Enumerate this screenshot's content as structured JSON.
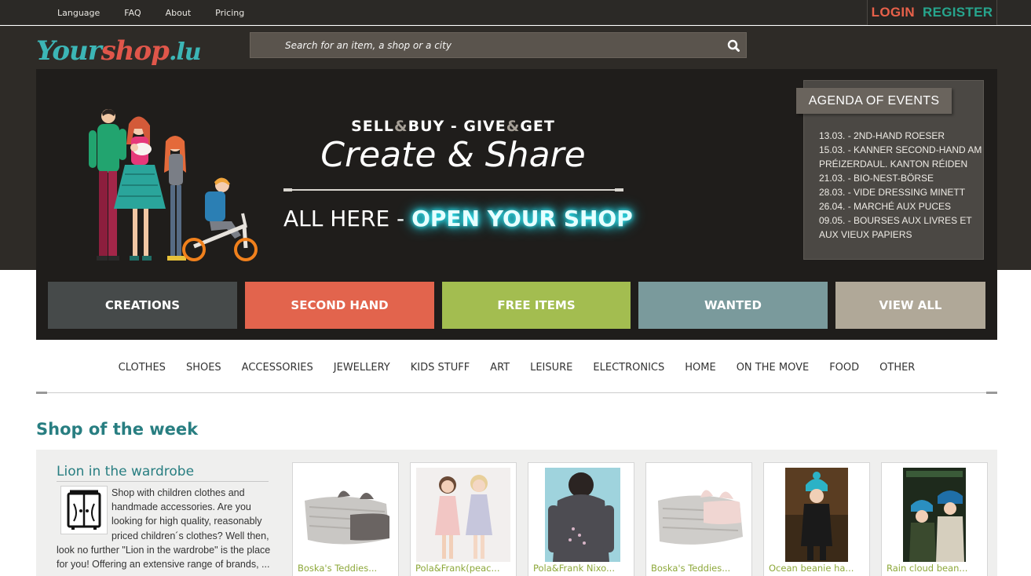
{
  "topbar": {
    "nav": [
      "Language",
      "FAQ",
      "About",
      "Pricing"
    ],
    "login": "LOGIN",
    "register": "REGISTER"
  },
  "header": {
    "logo": {
      "part1": "Your",
      "part2": "shop",
      "part3": ".lu"
    },
    "search_placeholder": "Search for an item, a shop or a city",
    "search_icon": "magnifier-icon"
  },
  "banner": {
    "line1": {
      "w1": "SELL",
      "amp1": "&",
      "w2": "BUY - GIVE",
      "amp2": "&",
      "w3": "GET"
    },
    "headline": "Create & Share",
    "all_here": "ALL HERE - ",
    "open_shop": "OPEN YOUR SHOP"
  },
  "agenda": {
    "title": "AGENDA OF EVENTS",
    "events": [
      "13.03. - 2ND-HAND ROESER",
      "15.03. - KANNER SECOND-HAND AM PRÉIZERDAUL. KANTON RÉIDEN",
      "21.03. - BIO-NEST-BÖRSE",
      "28.03. - VIDE DRESSING MINETT",
      "26.04. - MARCHÉ AUX PUCES",
      "09.05. - BOURSES AUX LIVRES ET AUX VIEUX PAPIERS"
    ]
  },
  "tiles": [
    "CREATIONS",
    "SECOND HAND",
    "FREE ITEMS",
    "WANTED",
    "VIEW ALL"
  ],
  "categories": [
    "CLOTHES",
    "SHOES",
    "ACCESSORIES",
    "JEWELLERY",
    "KIDS STUFF",
    "ART",
    "LEISURE",
    "ELECTRONICS",
    "HOME",
    "ON THE MOVE",
    "FOOD",
    "OTHER"
  ],
  "shop_of_week": {
    "title": "Shop of the week",
    "shop_name": "Lion in the wardrobe",
    "description": "Shop with children clothes and handmade accessories. Are you looking for high quality, reasonably priced children´s clothes? Well then, look no further \"Lion in the wardrobe\" is the place for you! Offering an extensive range of brands, ...",
    "products": [
      {
        "caption": "Boska's Teddies..."
      },
      {
        "caption": "Pola&Frank(peac..."
      },
      {
        "caption": "Pola&Frank Nixo..."
      },
      {
        "caption": "Boska's Teddies..."
      },
      {
        "caption": "Ocean beanie ha..."
      },
      {
        "caption": "Rain cloud bean..."
      }
    ]
  },
  "colors": {
    "creations": "#464a4a",
    "second_hand": "#e2644d",
    "free_items": "#a3bd50",
    "wanted": "#7a9a9c",
    "view_all": "#b0a898",
    "accent_teal": "#287e81",
    "caption_green": "#8da83a"
  }
}
